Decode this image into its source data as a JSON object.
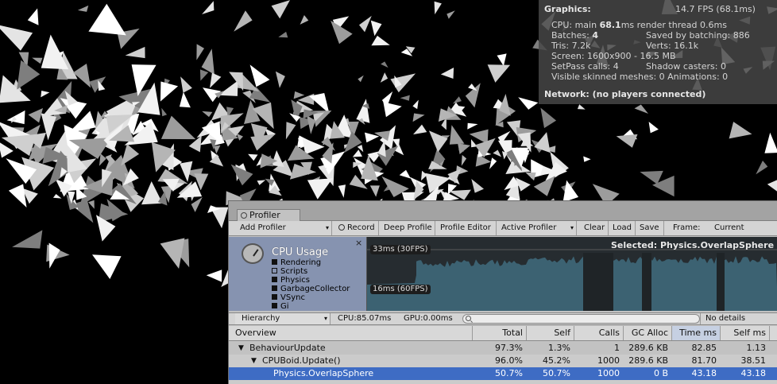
{
  "stats": {
    "graphics_label": "Graphics:",
    "fps": "14.7 FPS (68.1ms)",
    "cpu_prefix": "CPU: main ",
    "cpu_main": "68.1",
    "cpu_suffix": "ms  render thread 0.6ms",
    "batches_label": "Batches: ",
    "batches": "4",
    "saved_by_batching": "Saved by batching: 886",
    "tris": "Tris: 7.2k",
    "verts": "Verts: 16.1k",
    "screen": "Screen: 1600x900 - 16.5 MB",
    "setpass": "SetPass calls: 4",
    "shadow_casters": "Shadow casters: 0",
    "visible_skinned": "Visible skinned meshes: 0  Animations: 0",
    "network": "Network: (no players connected)"
  },
  "profiler": {
    "tab_label": "Profiler",
    "toolbar": {
      "add_profiler": "Add Profiler",
      "record": "Record",
      "deep_profile": "Deep Profile",
      "profile_editor": "Profile Editor",
      "active_profiler": "Active Profiler",
      "clear": "Clear",
      "load": "Load",
      "save": "Save",
      "frame_label": "Frame:",
      "frame_value": "Current"
    },
    "cpu_panel": {
      "title": "CPU Usage",
      "close": "×",
      "categories": [
        "Rendering",
        "Scripts",
        "Physics",
        "GarbageCollector",
        "VSync",
        "Gi"
      ]
    },
    "graph": {
      "label_30fps": "33ms (30FPS)",
      "label_60fps": "16ms (60FPS)",
      "selected": "Selected: Physics.OverlapSphere"
    },
    "hierarchy_bar": {
      "view_mode": "Hierarchy",
      "cpu_time": "CPU:85.07ms",
      "gpu_time": "GPU:0.00ms",
      "search_value": "",
      "details": "No details"
    },
    "table": {
      "columns": [
        "Overview",
        "Total",
        "Self",
        "Calls",
        "GC Alloc",
        "Time ms",
        "Self ms"
      ],
      "rows": [
        {
          "name": "BehaviourUpdate",
          "total": "97.3%",
          "self": "1.3%",
          "calls": "1",
          "gc": "289.6 KB",
          "time": "82.85",
          "selfms": "1.13"
        },
        {
          "name": "CPUBoid.Update()",
          "total": "96.0%",
          "self": "45.2%",
          "calls": "1000",
          "gc": "289.6 KB",
          "time": "81.70",
          "selfms": "38.51"
        },
        {
          "name": "Physics.OverlapSphere",
          "total": "50.7%",
          "self": "50.7%",
          "calls": "1000",
          "gc": "0 B",
          "time": "43.18",
          "selfms": "43.18"
        }
      ]
    }
  },
  "colors": {
    "selection": "#3e6cc4",
    "graph_bg": "#262c30",
    "graph_fill": "#3c6272",
    "cpu_panel": "#8693b0"
  }
}
